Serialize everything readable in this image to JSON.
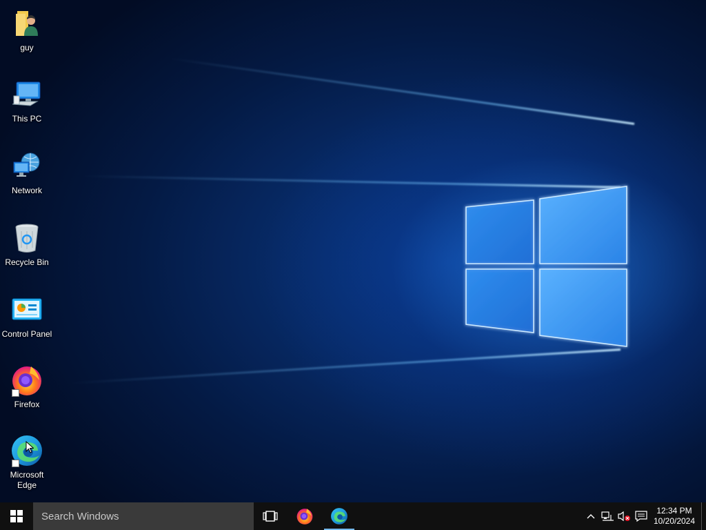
{
  "desktop": {
    "icons": [
      {
        "name": "guy",
        "icon": "user-folder-icon"
      },
      {
        "name": "This PC",
        "icon": "computer-icon"
      },
      {
        "name": "Network",
        "icon": "network-icon"
      },
      {
        "name": "Recycle Bin",
        "icon": "recycle-bin-icon"
      },
      {
        "name": "Control Panel",
        "icon": "control-panel-icon"
      },
      {
        "name": "Firefox",
        "icon": "firefox-icon"
      },
      {
        "name": "Microsoft Edge",
        "icon": "edge-icon"
      }
    ]
  },
  "taskbar": {
    "search_placeholder": "Search Windows",
    "pinned": [
      {
        "name": "Task View",
        "icon": "task-view-icon"
      },
      {
        "name": "Firefox",
        "icon": "firefox-icon"
      },
      {
        "name": "Microsoft Edge",
        "icon": "edge-icon",
        "active": true
      }
    ],
    "tray": {
      "time": "12:34 PM",
      "date": "10/20/2024"
    }
  },
  "colors": {
    "taskbar": "#101010",
    "search": "#3a3a3a",
    "accent": "#76b9ed",
    "wallpaper": "#0a3a8a"
  }
}
